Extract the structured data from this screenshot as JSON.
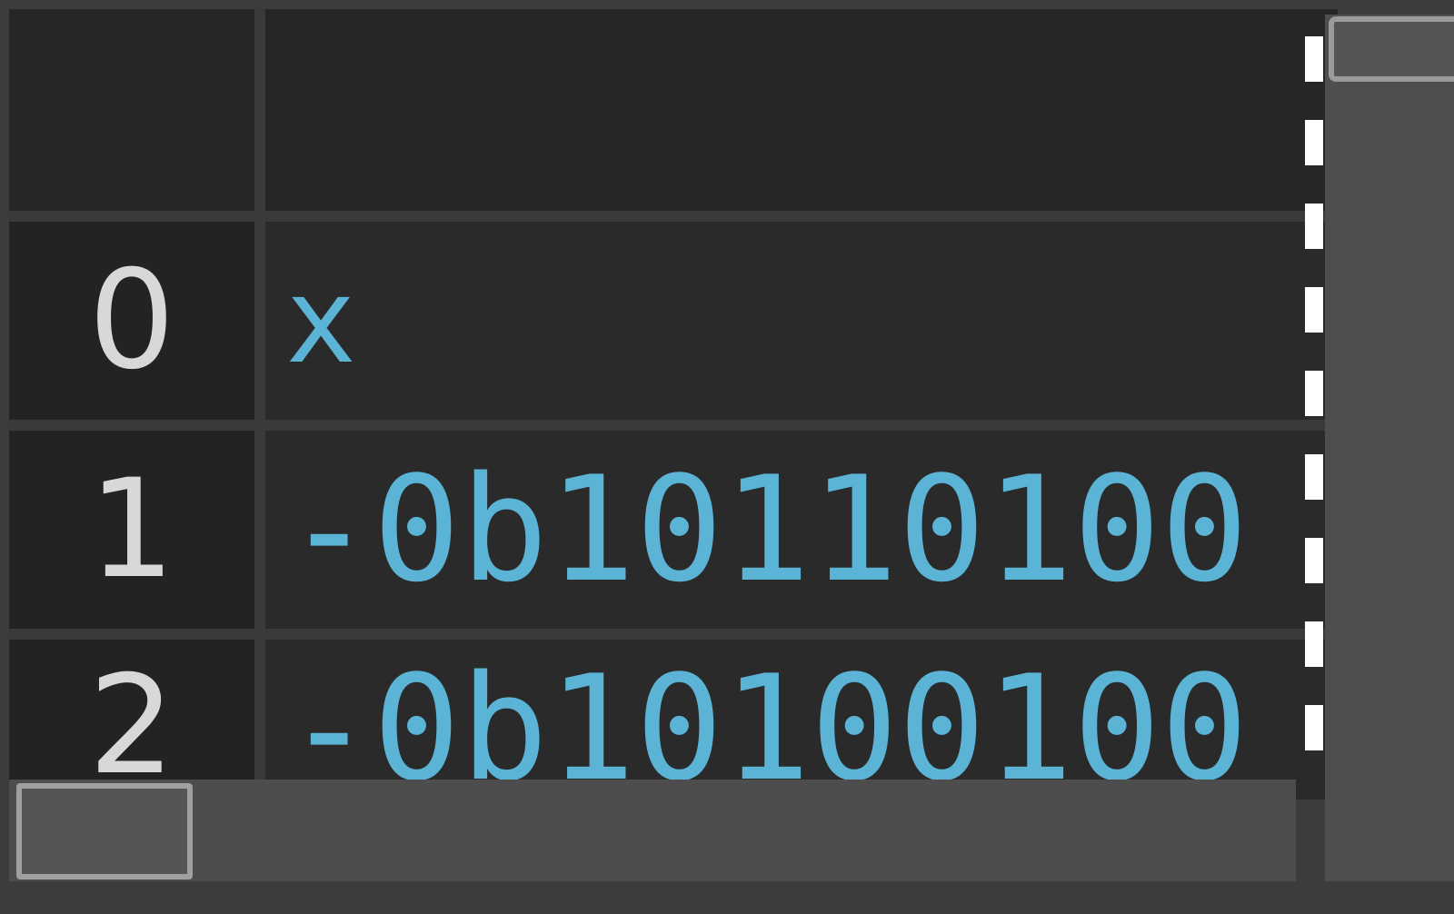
{
  "table": {
    "header": {
      "index": "",
      "value": ""
    },
    "rows": [
      {
        "index": "0",
        "value": "x"
      },
      {
        "index": "1",
        "value": "-0b10110100"
      },
      {
        "index": "2",
        "value": "-0b10100100"
      }
    ]
  },
  "colors": {
    "value_text": "#5bb4d6",
    "index_text": "#d8d8d8",
    "cell_background": "#2a2a2a",
    "gridline": "#3a3a3a",
    "selection_border": "#ffffff"
  }
}
